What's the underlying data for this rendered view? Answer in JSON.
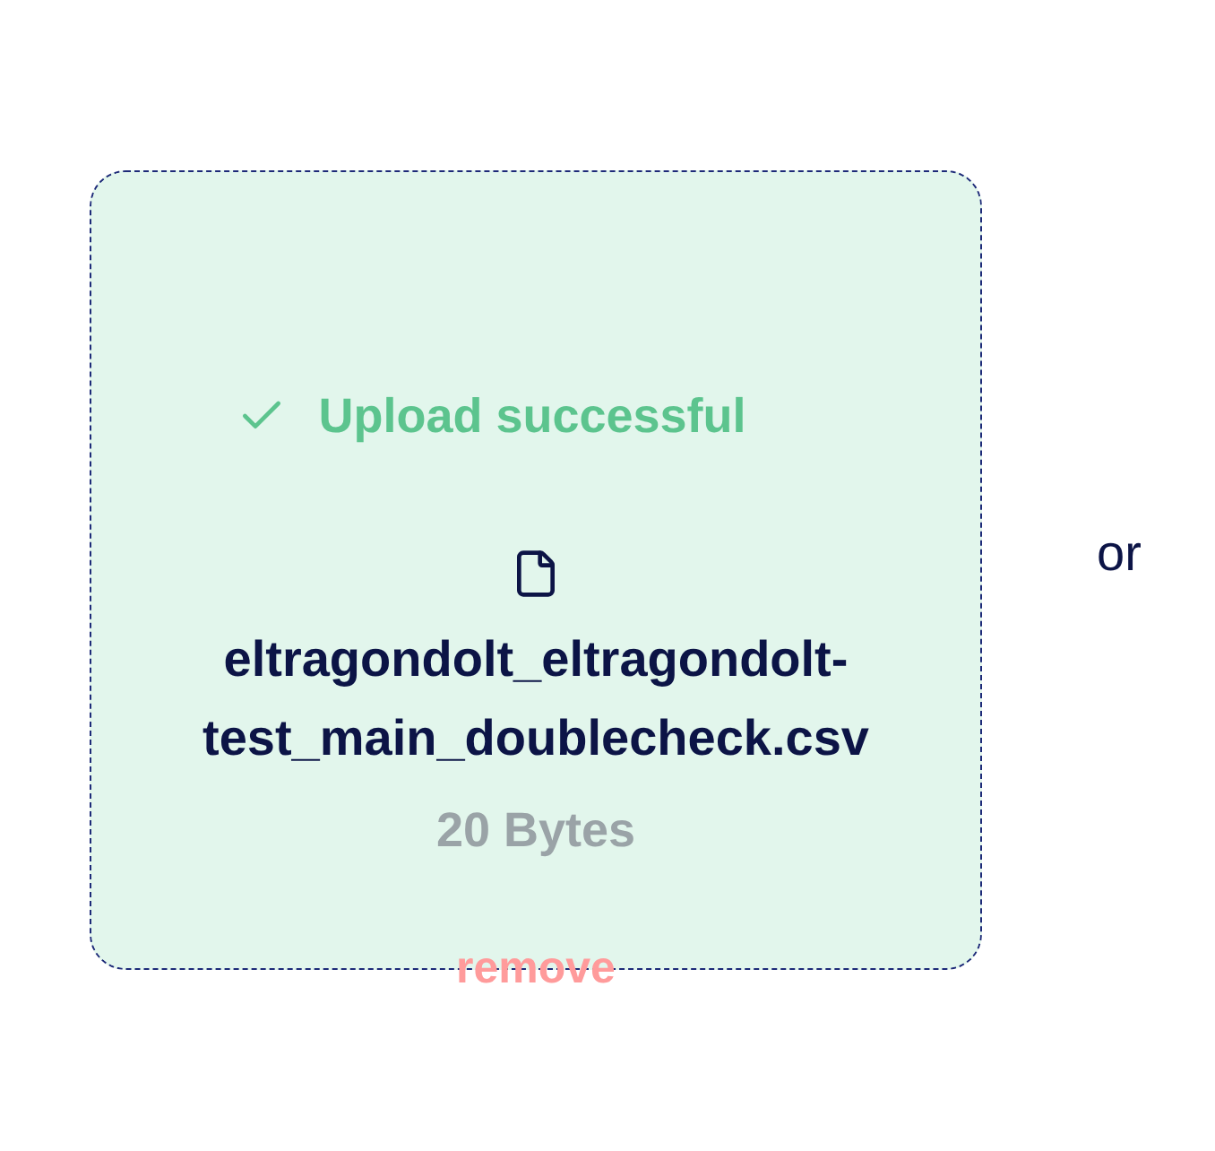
{
  "upload": {
    "status": {
      "kind": "success",
      "text": "Upload successful"
    },
    "file": {
      "name": "eltragondolt_eltragondolt-test_main_doublecheck.csv",
      "size": "20 Bytes"
    },
    "remove_label": "remove"
  },
  "alternative": "or"
}
